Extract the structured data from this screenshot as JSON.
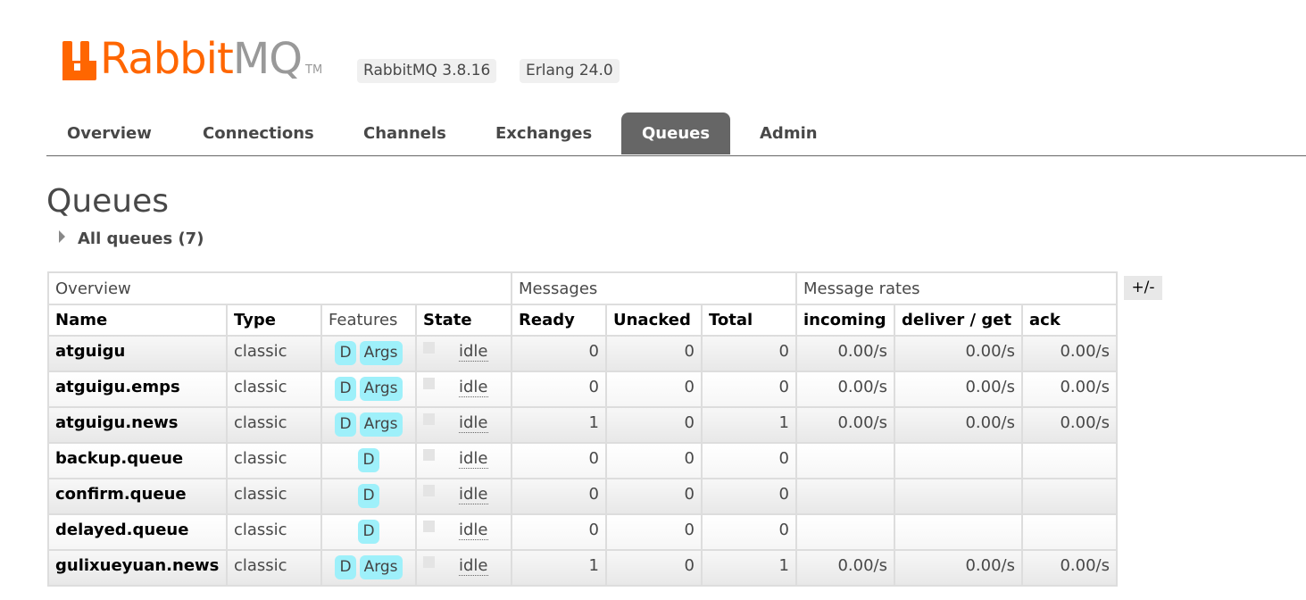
{
  "brand": {
    "name_rabbit": "Rabbit",
    "name_mq": "MQ",
    "tm": "TM",
    "color": "#ff6600"
  },
  "versions": {
    "rabbitmq": "RabbitMQ 3.8.16",
    "erlang": "Erlang 24.0"
  },
  "nav": {
    "tabs": [
      "Overview",
      "Connections",
      "Channels",
      "Exchanges",
      "Queues",
      "Admin"
    ],
    "active": "Queues"
  },
  "page": {
    "title": "Queues",
    "section_label": "All queues (7)"
  },
  "table": {
    "groups": {
      "overview": "Overview",
      "messages": "Messages",
      "rates": "Message rates"
    },
    "columns": [
      "Name",
      "Type",
      "Features",
      "State",
      "Ready",
      "Unacked",
      "Total",
      "incoming",
      "deliver / get",
      "ack"
    ],
    "toggle_columns_label": "+/-",
    "rows": [
      {
        "name": "atguigu",
        "type": "classic",
        "f1": "D",
        "f2": "Args",
        "state": "idle",
        "ready": "0",
        "unacked": "0",
        "total": "0",
        "incoming": "0.00/s",
        "deliver": "0.00/s",
        "ack": "0.00/s"
      },
      {
        "name": "atguigu.emps",
        "type": "classic",
        "f1": "D",
        "f2": "Args",
        "state": "idle",
        "ready": "0",
        "unacked": "0",
        "total": "0",
        "incoming": "0.00/s",
        "deliver": "0.00/s",
        "ack": "0.00/s"
      },
      {
        "name": "atguigu.news",
        "type": "classic",
        "f1": "D",
        "f2": "Args",
        "state": "idle",
        "ready": "1",
        "unacked": "0",
        "total": "1",
        "incoming": "0.00/s",
        "deliver": "0.00/s",
        "ack": "0.00/s"
      },
      {
        "name": "backup.queue",
        "type": "classic",
        "f1": "D",
        "f2": "",
        "state": "idle",
        "ready": "0",
        "unacked": "0",
        "total": "0",
        "incoming": "",
        "deliver": "",
        "ack": ""
      },
      {
        "name": "confirm.queue",
        "type": "classic",
        "f1": "D",
        "f2": "",
        "state": "idle",
        "ready": "0",
        "unacked": "0",
        "total": "0",
        "incoming": "",
        "deliver": "",
        "ack": ""
      },
      {
        "name": "delayed.queue",
        "type": "classic",
        "f1": "D",
        "f2": "",
        "state": "idle",
        "ready": "0",
        "unacked": "0",
        "total": "0",
        "incoming": "",
        "deliver": "",
        "ack": ""
      },
      {
        "name": "gulixueyuan.news",
        "type": "classic",
        "f1": "D",
        "f2": "Args",
        "state": "idle",
        "ready": "1",
        "unacked": "0",
        "total": "1",
        "incoming": "0.00/s",
        "deliver": "0.00/s",
        "ack": "0.00/s"
      }
    ]
  }
}
